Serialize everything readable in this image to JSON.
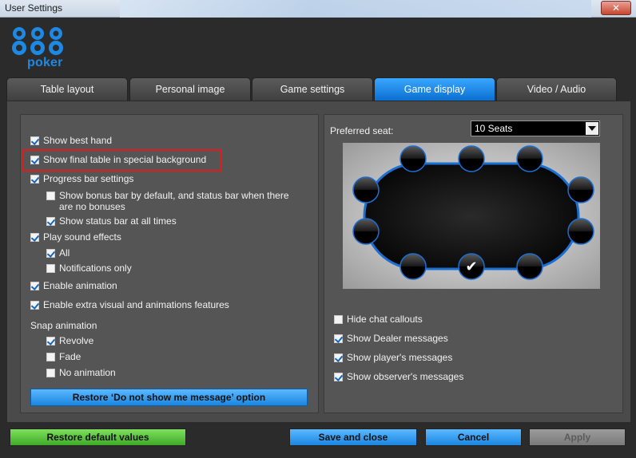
{
  "window": {
    "title": "User Settings",
    "close": "✕"
  },
  "brand": {
    "logo_number": "888",
    "logo_word": "poker",
    "accent": "#1e88e5"
  },
  "tabs": [
    {
      "label": "Table layout",
      "active": false
    },
    {
      "label": "Personal image",
      "active": false
    },
    {
      "label": "Game settings",
      "active": false
    },
    {
      "label": "Game display",
      "active": true
    },
    {
      "label": "Video / Audio",
      "active": false
    }
  ],
  "left": {
    "show_best_hand": {
      "label": "Show best hand",
      "checked": true
    },
    "show_final_table": {
      "label": "Show final table in special background",
      "checked": true
    },
    "progress_bar": {
      "label": "Progress bar settings",
      "checked": true
    },
    "bonus_bar": {
      "label": "Show bonus bar by default, and status bar when there",
      "label_cont": "are no bonuses",
      "checked": false
    },
    "status_bar": {
      "label": "Show status bar at all times",
      "checked": true
    },
    "play_sound": {
      "label": "Play sound effects",
      "checked": true
    },
    "sound_all": {
      "label": "All",
      "checked": true
    },
    "sound_notifications": {
      "label": "Notifications only",
      "checked": false
    },
    "enable_animation": {
      "label": "Enable animation",
      "checked": true
    },
    "extra_visual": {
      "label": "Enable extra visual and animations features",
      "checked": true
    },
    "snap_animation_label": "Snap animation",
    "revolve": {
      "label": "Revolve",
      "checked": true
    },
    "fade": {
      "label": "Fade",
      "checked": false
    },
    "no_animation": {
      "label": "No animation",
      "checked": false
    },
    "restore_message_button": "Restore ‘Do not show me message’ option"
  },
  "right": {
    "preferred_seat_label": "Preferred seat:",
    "seats_dropdown": {
      "value": "10 Seats"
    },
    "selected_seat_mark": "✔",
    "hide_chat": {
      "label": "Hide chat callouts",
      "checked": false
    },
    "dealer_messages": {
      "label": "Show Dealer messages",
      "checked": true
    },
    "player_messages": {
      "label": "Show player's messages",
      "checked": true
    },
    "observer_messages": {
      "label": "Show observer's messages",
      "checked": true
    }
  },
  "footer": {
    "restore_defaults": "Restore default values",
    "save_close": "Save and close",
    "cancel": "Cancel",
    "apply": "Apply"
  },
  "colors": {
    "tab_active": "#1479d8",
    "highlight_box": "#e01b1b",
    "btn_green": "#4fbf35",
    "btn_blue": "#2a93e8"
  }
}
